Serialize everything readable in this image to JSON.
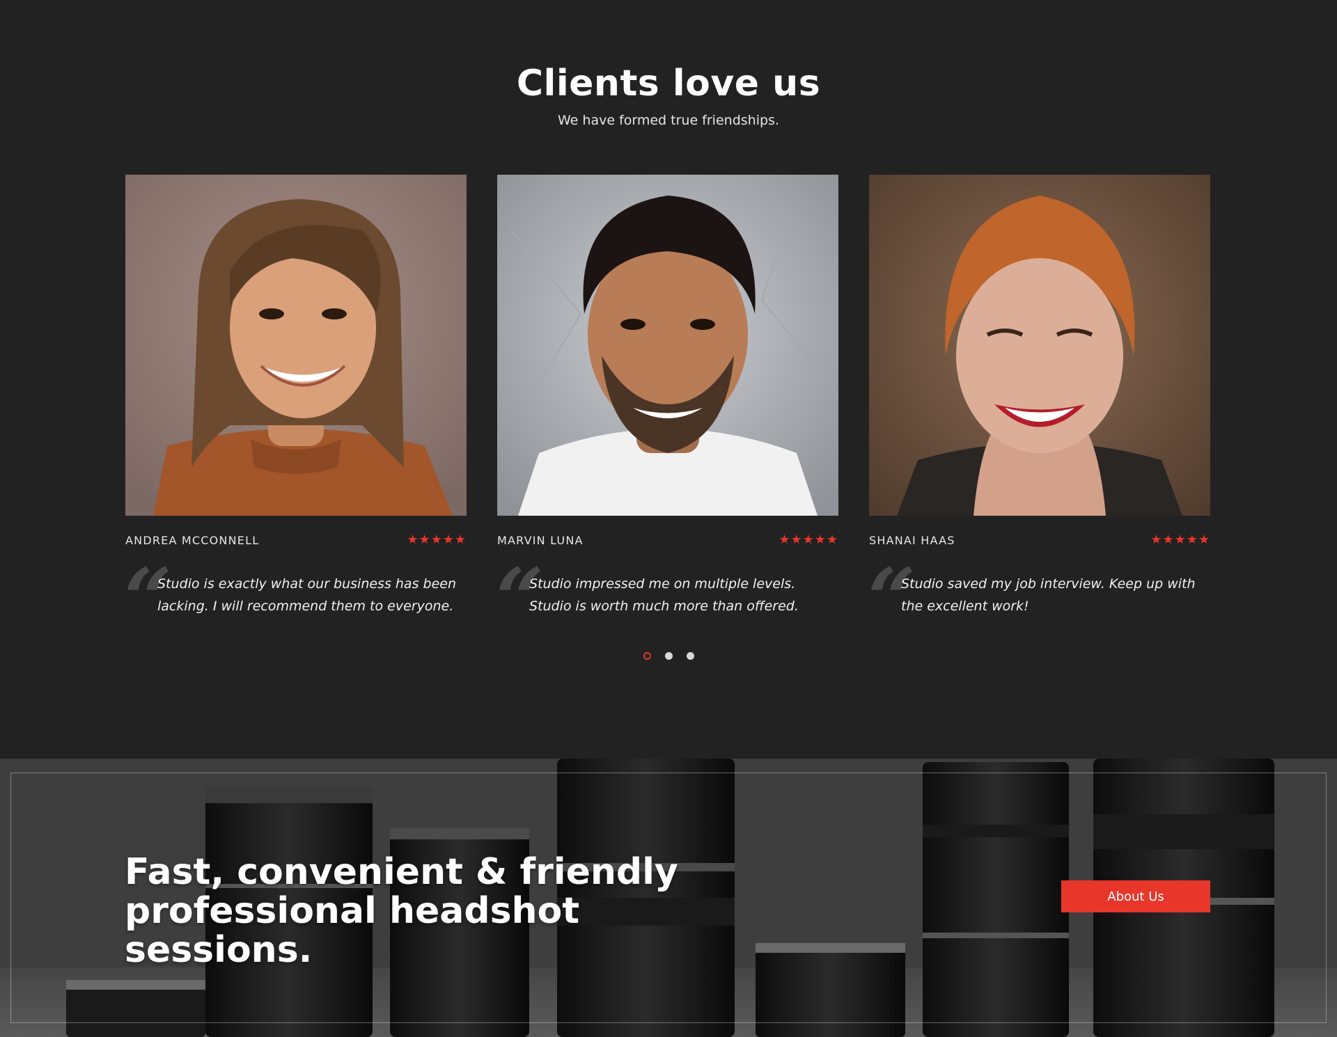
{
  "header": {
    "title": "Clients love us",
    "subtitle": "We have formed true friendships."
  },
  "testimonials": [
    {
      "name": "ANDREA MCCONNELL",
      "rating": 5,
      "stars": "★★★★★",
      "quote": "Studio is exactly what our business has been lacking. I will recommend them to everyone."
    },
    {
      "name": "MARVIN LUNA",
      "rating": 5,
      "stars": "★★★★★",
      "quote": "Studio impressed me on multiple levels. Studio is worth much more than offered."
    },
    {
      "name": "SHANAI HAAS",
      "rating": 5,
      "stars": "★★★★★",
      "quote": "Studio saved my job interview. Keep up with the excellent work!"
    }
  ],
  "quote_mark": "“",
  "carousel": {
    "pages": 3,
    "active_index": 0
  },
  "banner": {
    "heading_line1": "Fast, convenient & friendly",
    "heading_line2": "professional headshot sessions.",
    "button_label": "About Us"
  },
  "colors": {
    "background": "#222222",
    "accent": "#e8362b",
    "text": "#ffffff"
  }
}
